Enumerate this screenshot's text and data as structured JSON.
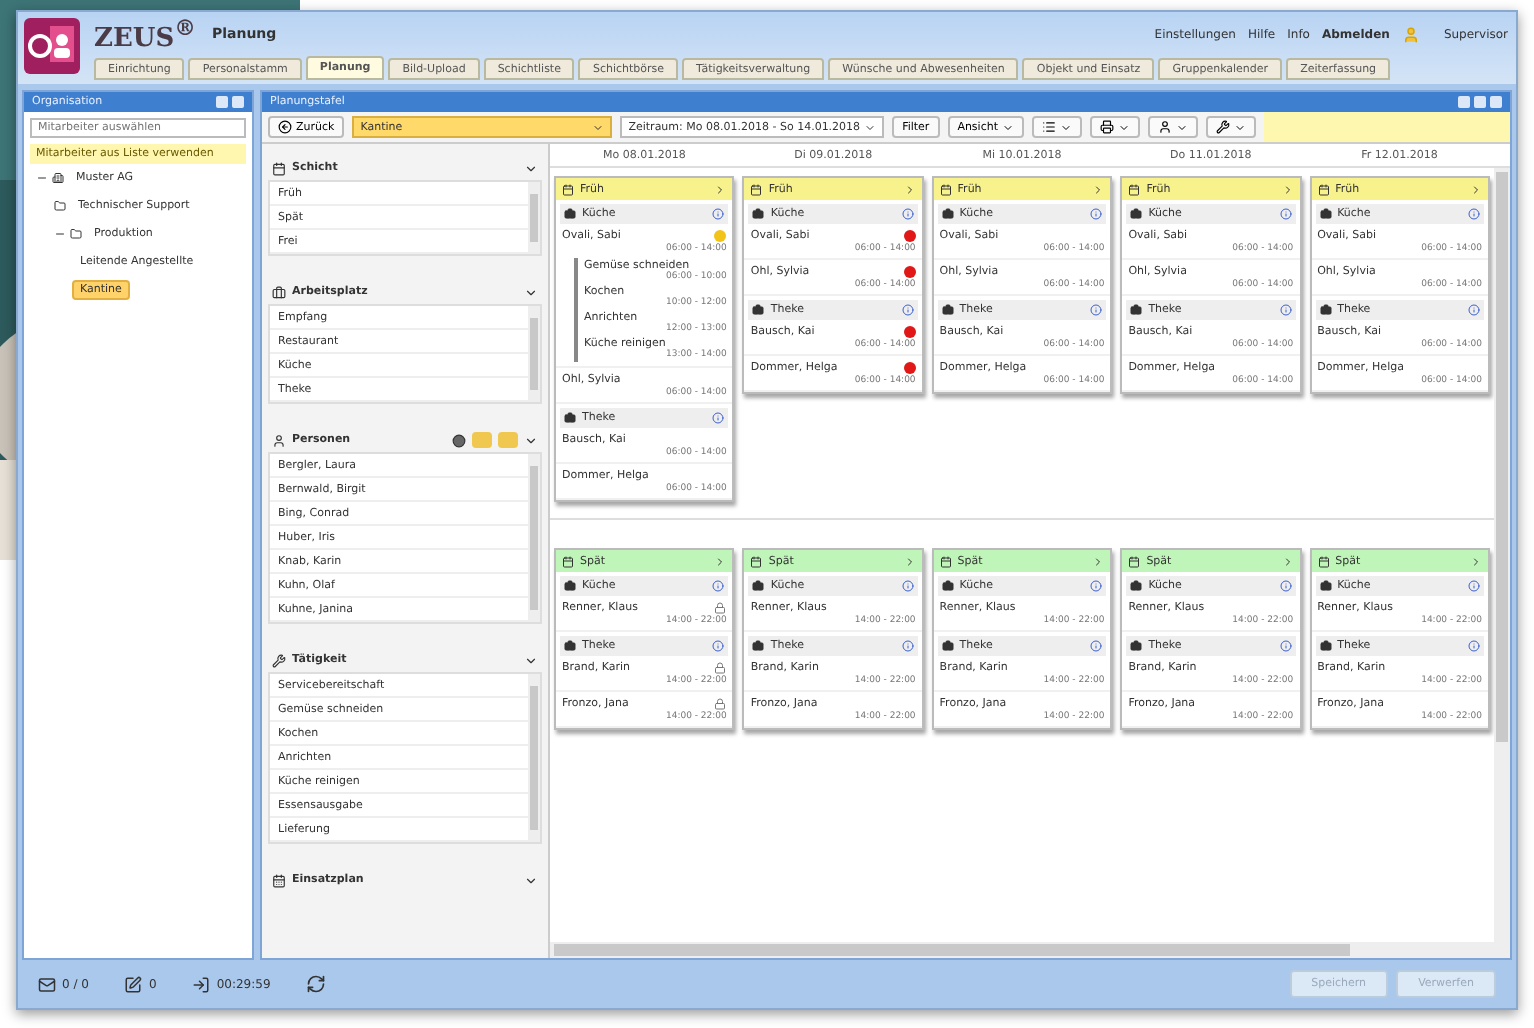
{
  "app": {
    "name": "ZEUS",
    "mark": "®",
    "module": "Planung"
  },
  "header_links": [
    {
      "label": "Einstellungen",
      "strong": false
    },
    {
      "label": "Hilfe",
      "strong": false
    },
    {
      "label": "Info",
      "strong": false
    },
    {
      "label": "Abmelden",
      "strong": true
    }
  ],
  "user": "Supervisor",
  "tabs": [
    {
      "label": "Einrichtung",
      "selected": false
    },
    {
      "label": "Personalstamm",
      "selected": false
    },
    {
      "label": "Planung",
      "selected": true
    },
    {
      "label": "Bild-Upload",
      "selected": false
    },
    {
      "label": "Schichtliste",
      "selected": false
    },
    {
      "label": "Schichtbörse",
      "selected": false
    },
    {
      "label": "Tätigkeitsverwaltung",
      "selected": false
    },
    {
      "label": "Wünsche und Abwesenheiten",
      "selected": false
    },
    {
      "label": "Objekt und Einsatz",
      "selected": false
    },
    {
      "label": "Gruppenkalender",
      "selected": false
    },
    {
      "label": "Zeiterfassung",
      "selected": false
    }
  ],
  "organisation": {
    "title": "Organisation",
    "search": {
      "placeholder": "Mitarbeiter auswählen"
    },
    "notice": "Mitarbeiter aus Liste verwenden",
    "tree": [
      {
        "label": "Muster AG",
        "expanded": true,
        "selected": false,
        "children": [
          {
            "label": "Technischer Support",
            "selected": false
          },
          {
            "label": "Produktion",
            "expanded": true,
            "selected": false,
            "children": [
              {
                "label": "Leitende Angestellte",
                "selected": false
              },
              {
                "label": "Kantine",
                "selected": true
              }
            ]
          }
        ]
      }
    ]
  },
  "planning": {
    "title": "Planungstafel",
    "back": "Zurück",
    "unit": "Kantine",
    "period": "Zeitraum: Mo 08.01.2018 - So 14.01.2018",
    "filter": "Filter",
    "view": "Ansicht"
  },
  "filters": [
    {
      "title": "Schicht",
      "items": [
        "Früh",
        "Spät",
        "Frei"
      ]
    },
    {
      "title": "Arbeitsplatz",
      "items": [
        "Empfang",
        "Restaurant",
        "Küche",
        "Theke"
      ]
    },
    {
      "title": "Personen",
      "items": [
        "Bergler, Laura",
        "Bernwald, Birgit",
        "Bing, Conrad",
        "Huber, Iris",
        "Knab, Karin",
        "Kuhn, Olaf",
        "Kuhne, Janina"
      ]
    },
    {
      "title": "Tätigkeit",
      "items": [
        "Servicebereitschaft",
        "Gemüse schneiden",
        "Kochen",
        "Anrichten",
        "Küche reinigen",
        "Essensausgabe",
        "Lieferung"
      ]
    },
    {
      "title": "Einsatzplan"
    }
  ],
  "days": [
    "Mo 08.01.2018",
    "Di 09.01.2018",
    "Mi 10.01.2018",
    "Do 11.01.2018",
    "Fr 12.01.2018"
  ],
  "shifts": [
    {
      "days": [
        {
          "name": "Früh",
          "color": "#f7f28c",
          "groups": [
            {
              "name": "Küche",
              "people": [
                {
                  "name": "Ovali, Sabi",
                  "time": "06:00 - 14:00",
                  "color": "#f2c318",
                  "tasks": [
                    {
                      "name": "Gemüse schneiden",
                      "time": "06:00 - 10:00"
                    },
                    {
                      "name": "Kochen",
                      "time": "10:00 - 12:00"
                    },
                    {
                      "name": "Anrichten",
                      "time": "12:00 - 13:00"
                    },
                    {
                      "name": "Küche reinigen",
                      "time": "13:00 - 14:00"
                    }
                  ]
                },
                {
                  "name": "Ohl, Sylvia",
                  "time": "06:00 - 14:00"
                }
              ]
            },
            {
              "name": "Theke",
              "people": [
                {
                  "name": "Bausch, Kai",
                  "time": "06:00 - 14:00"
                },
                {
                  "name": "Dommer, Helga",
                  "time": "06:00 - 14:00"
                }
              ]
            }
          ]
        },
        {
          "name": "Früh",
          "color": "#f7f28c",
          "groups": [
            {
              "name": "Küche",
              "people": [
                {
                  "name": "Ovali, Sabi",
                  "time": "06:00 - 14:00",
                  "color": "#e01818"
                },
                {
                  "name": "Ohl, Sylvia",
                  "time": "06:00 - 14:00",
                  "color": "#e01818"
                }
              ]
            },
            {
              "name": "Theke",
              "people": [
                {
                  "name": "Bausch, Kai",
                  "time": "06:00 - 14:00",
                  "color": "#e01818"
                },
                {
                  "name": "Dommer, Helga",
                  "time": "06:00 - 14:00",
                  "color": "#e01818"
                }
              ]
            }
          ]
        },
        {
          "name": "Früh",
          "color": "#f7f28c",
          "groups": [
            {
              "name": "Küche",
              "people": [
                {
                  "name": "Ovali, Sabi",
                  "time": "06:00 - 14:00"
                },
                {
                  "name": "Ohl, Sylvia",
                  "time": "06:00 - 14:00"
                }
              ]
            },
            {
              "name": "Theke",
              "people": [
                {
                  "name": "Bausch, Kai",
                  "time": "06:00 - 14:00"
                },
                {
                  "name": "Dommer, Helga",
                  "time": "06:00 - 14:00"
                }
              ]
            }
          ]
        },
        {
          "name": "Früh",
          "color": "#f7f28c",
          "groups": [
            {
              "name": "Küche",
              "people": [
                {
                  "name": "Ovali, Sabi",
                  "time": "06:00 - 14:00"
                },
                {
                  "name": "Ohl, Sylvia",
                  "time": "06:00 - 14:00"
                }
              ]
            },
            {
              "name": "Theke",
              "people": [
                {
                  "name": "Bausch, Kai",
                  "time": "06:00 - 14:00"
                },
                {
                  "name": "Dommer, Helga",
                  "time": "06:00 - 14:00"
                }
              ]
            }
          ]
        },
        {
          "name": "Früh",
          "color": "#f7f28c",
          "groups": [
            {
              "name": "Küche",
              "people": [
                {
                  "name": "Ovali, Sabi",
                  "time": "06:00 - 14:00"
                },
                {
                  "name": "Ohl, Sylvia",
                  "time": "06:00 - 14:00"
                }
              ]
            },
            {
              "name": "Theke",
              "people": [
                {
                  "name": "Bausch, Kai",
                  "time": "06:00 - 14:00"
                },
                {
                  "name": "Dommer, Helga",
                  "time": "06:00 - 14:00"
                }
              ]
            }
          ]
        }
      ]
    },
    {
      "days": [
        {
          "name": "Spät",
          "color": "#bff5b8",
          "groups": [
            {
              "name": "Küche",
              "people": [
                {
                  "name": "Renner, Klaus",
                  "time": "14:00 - 22:00",
                  "locked": true
                }
              ]
            },
            {
              "name": "Theke",
              "people": [
                {
                  "name": "Brand, Karin",
                  "time": "14:00 - 22:00",
                  "locked": true
                },
                {
                  "name": "Fronzo, Jana",
                  "time": "14:00 - 22:00",
                  "locked": true
                }
              ]
            }
          ]
        },
        {
          "name": "Spät",
          "color": "#bff5b8",
          "groups": [
            {
              "name": "Küche",
              "people": [
                {
                  "name": "Renner, Klaus",
                  "time": "14:00 - 22:00",
                  "locked": false
                }
              ]
            },
            {
              "name": "Theke",
              "people": [
                {
                  "name": "Brand, Karin",
                  "time": "14:00 - 22:00",
                  "locked": false
                },
                {
                  "name": "Fronzo, Jana",
                  "time": "14:00 - 22:00",
                  "locked": false
                }
              ]
            }
          ]
        },
        {
          "name": "Spät",
          "color": "#bff5b8",
          "groups": [
            {
              "name": "Küche",
              "people": [
                {
                  "name": "Renner, Klaus",
                  "time": "14:00 - 22:00",
                  "locked": false
                }
              ]
            },
            {
              "name": "Theke",
              "people": [
                {
                  "name": "Brand, Karin",
                  "time": "14:00 - 22:00",
                  "locked": false
                },
                {
                  "name": "Fronzo, Jana",
                  "time": "14:00 - 22:00",
                  "locked": false
                }
              ]
            }
          ]
        },
        {
          "name": "Spät",
          "color": "#bff5b8",
          "groups": [
            {
              "name": "Küche",
              "people": [
                {
                  "name": "Renner, Klaus",
                  "time": "14:00 - 22:00",
                  "locked": false
                }
              ]
            },
            {
              "name": "Theke",
              "people": [
                {
                  "name": "Brand, Karin",
                  "time": "14:00 - 22:00",
                  "locked": false
                },
                {
                  "name": "Fronzo, Jana",
                  "time": "14:00 - 22:00",
                  "locked": false
                }
              ]
            }
          ]
        },
        {
          "name": "Spät",
          "color": "#bff5b8",
          "groups": [
            {
              "name": "Küche",
              "people": [
                {
                  "name": "Renner, Klaus",
                  "time": "14:00 - 22:00",
                  "locked": false
                }
              ]
            },
            {
              "name": "Theke",
              "people": [
                {
                  "name": "Brand, Karin",
                  "time": "14:00 - 22:00",
                  "locked": false
                },
                {
                  "name": "Fronzo, Jana",
                  "time": "14:00 - 22:00",
                  "locked": false
                }
              ]
            }
          ]
        }
      ]
    }
  ],
  "status_bar": {
    "messages": "0 / 0",
    "edits": "0",
    "timer": "00:29:59"
  },
  "buttons": [
    {
      "label": "Speichern",
      "disabled": true
    },
    {
      "label": "Verwerfen",
      "disabled": true
    }
  ]
}
